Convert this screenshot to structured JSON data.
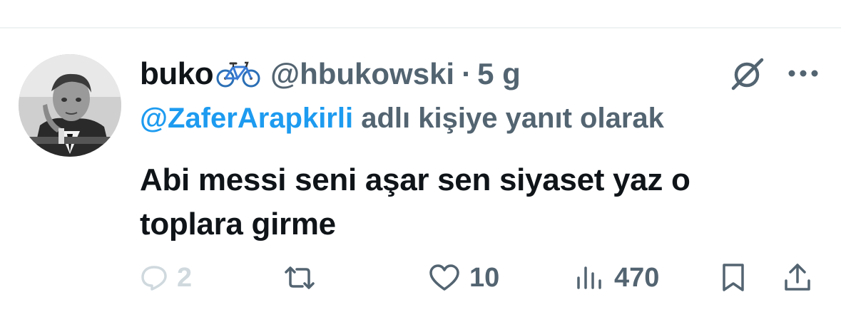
{
  "author": {
    "display_name": "buko",
    "emoji_icon": "bicycle-icon",
    "handle": "@hbukowski",
    "separator": "·",
    "time": "5 g"
  },
  "reply_to": {
    "mention": "@ZaferArapkirli",
    "suffix": " adlı kişiye yanıt olarak"
  },
  "tweet": {
    "text": "Abi messi seni aşar sen siyaset yaz o toplara girme"
  },
  "actions": {
    "reply_count": "2",
    "retweet_count": "",
    "like_count": "10",
    "views_count": "470"
  },
  "colors": {
    "primary_text": "#0f1419",
    "secondary_text": "#536471",
    "link": "#1d9bf0",
    "disabled": "#cfd9de"
  }
}
